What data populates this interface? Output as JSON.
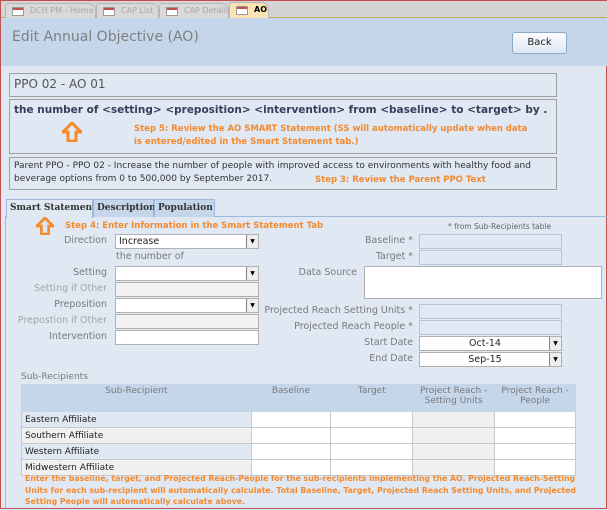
{
  "doc_tabs": [
    {
      "label": "DCH PM - Home"
    },
    {
      "label": "CAP List"
    },
    {
      "label": "CAP Details"
    },
    {
      "label": "AO",
      "active": true
    }
  ],
  "header": {
    "title": "Edit Annual Objective (AO)",
    "back_label": "Back"
  },
  "ao_id": "PPO 02 - AO 01",
  "smart_statement": "the number of <setting> <preposition> <intervention> from <baseline> to <target> by .",
  "step5": "Step 5: Review the AO SMART Statement (SS will automatically update when data",
  "step5b": "is entered/edited in the Smart Statement tab.)",
  "parent_ppo": "Parent PPO - PPO 02 - Increase the number of people with improved access to environments with healthy food and beverage options from 0 to 500,000 by September 2017.",
  "step3": "Step 3: Review the Parent PPO Text",
  "form_tabs": [
    {
      "label": "Smart Statement"
    },
    {
      "label": "Description"
    },
    {
      "label": "Population"
    }
  ],
  "step4": "Step 4: Enter Information in the Smart Statement Tab",
  "from_note": "* from Sub-Recipients table",
  "fields": {
    "direction_label": "Direction",
    "direction_value": "Increase",
    "number_of": "the number of",
    "setting_label": "Setting",
    "setting_value": "",
    "setting_other_label": "Setting if Other",
    "preposition_label": "Preposition",
    "preposition_value": "",
    "preposition_other_label": "Prepostion if Other",
    "intervention_label": "Intervention",
    "intervention_value": "",
    "baseline_label": "Baseline *",
    "target_label": "Target *",
    "data_source_label": "Data Source",
    "reach_units_label": "Projected Reach Setting Units *",
    "reach_people_label": "Projected Reach People *",
    "start_label": "Start Date",
    "start_value": "Oct-14",
    "end_label": "End Date",
    "end_value": "Sep-15"
  },
  "subrecipients": {
    "label": "Sub-Recipients",
    "columns": [
      "Sub-Recipient",
      "Baseline",
      "Target",
      "Project Reach - Setting Units",
      "Project Reach - People"
    ],
    "rows": [
      {
        "name": "Eastern Affiliate"
      },
      {
        "name": "Southern Affiliate"
      },
      {
        "name": "Western Affiliate"
      },
      {
        "name": "Midwestern Affiliate"
      }
    ]
  },
  "note": "Enter the baseline, target, and Projected Reach-People for the sub-recipients implementing the AO. Projected Reach-Setting Units for each sub-recipient will automatically calculate. Total Baseline, Target, Projected Reach Setting Units, and Projected Setting People will automatically calculate above.",
  "colors": {
    "accent": "#f58a2d",
    "header_bg": "#c5d6eb",
    "form_bg": "#dfe8f3"
  }
}
